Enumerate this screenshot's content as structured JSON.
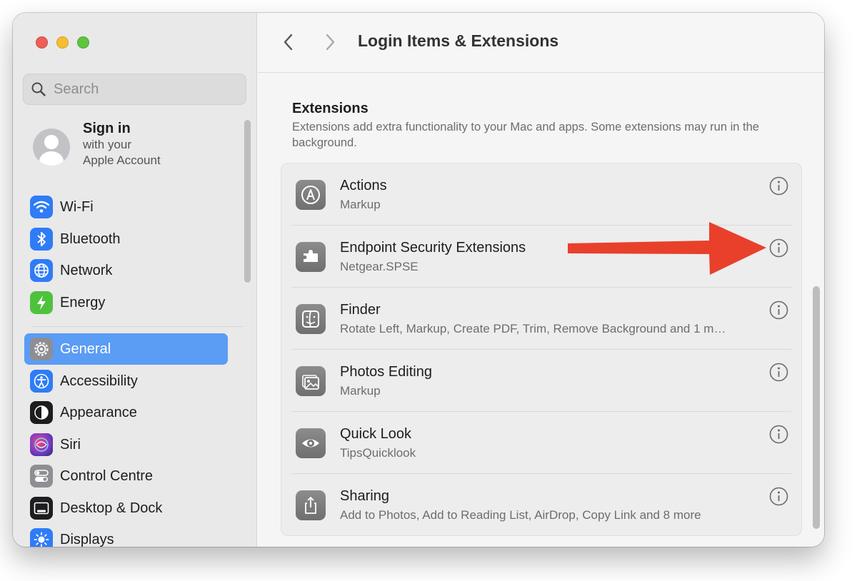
{
  "sidebar": {
    "search": {
      "placeholder": "Search"
    },
    "account": {
      "title": "Sign in",
      "line1": "with your",
      "line2": "Apple Account"
    },
    "items": [
      {
        "label": "Wi-Fi",
        "icon": "wifi-icon",
        "color": "#2f7cf6"
      },
      {
        "label": "Bluetooth",
        "icon": "bluetooth-icon",
        "color": "#2f7cf6"
      },
      {
        "label": "Network",
        "icon": "globe-icon",
        "color": "#2f7cf6"
      },
      {
        "label": "Energy",
        "icon": "bolt-icon",
        "color": "#4fc23d"
      },
      {
        "label": "General",
        "icon": "gear-icon",
        "color": "#8e8e93",
        "selected": true
      },
      {
        "label": "Accessibility",
        "icon": "accessibility-icon",
        "color": "#2f7cf6"
      },
      {
        "label": "Appearance",
        "icon": "appearance-icon",
        "color": "#1d1d1f"
      },
      {
        "label": "Siri",
        "icon": "siri-icon",
        "color": "#7a3cc6"
      },
      {
        "label": "Control Centre",
        "icon": "toggles-icon",
        "color": "#8e8e93"
      },
      {
        "label": "Desktop & Dock",
        "icon": "dock-icon",
        "color": "#1d1d1f"
      },
      {
        "label": "Displays",
        "icon": "sun-icon",
        "color": "#2f7cf6"
      }
    ]
  },
  "header": {
    "title": "Login Items & Extensions"
  },
  "extensions": {
    "title": "Extensions",
    "description": "Extensions add extra functionality to your Mac and apps. Some extensions may run in the background.",
    "rows": [
      {
        "title": "Actions",
        "subtitle": "Markup",
        "icon": "markup-icon"
      },
      {
        "title": "Endpoint Security Extensions",
        "subtitle": "Netgear.SPSE",
        "icon": "puzzle-icon"
      },
      {
        "title": "Finder",
        "subtitle": "Rotate Left, Markup, Create PDF, Trim, Remove Background and 1 m…",
        "icon": "finder-icon"
      },
      {
        "title": "Photos Editing",
        "subtitle": "Markup",
        "icon": "photos-icon"
      },
      {
        "title": "Quick Look",
        "subtitle": "TipsQuicklook",
        "icon": "eye-icon"
      },
      {
        "title": "Sharing",
        "subtitle": "Add to Photos, Add to Reading List, AirDrop, Copy Link and 8 more",
        "icon": "share-icon"
      }
    ]
  },
  "annotation": {
    "arrow_color": "#e8402b"
  }
}
